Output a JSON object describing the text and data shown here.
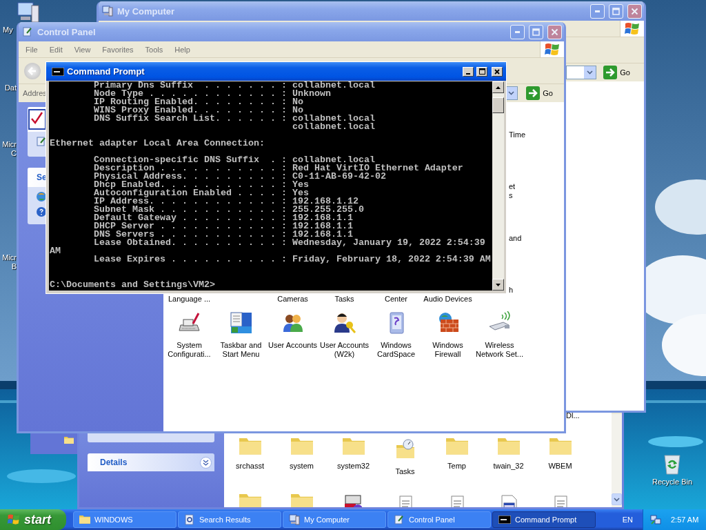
{
  "desktop": {
    "icons": [
      {
        "kind": "computer",
        "lines": [
          "My"
        ]
      },
      {
        "kind": "label",
        "lines": [
          "Dat"
        ]
      },
      {
        "kind": "label",
        "lines": [
          "Micr",
          "C"
        ]
      },
      {
        "kind": "label",
        "lines": [
          "Micr",
          "B"
        ]
      }
    ],
    "recycle_bin": {
      "label": "Recycle Bin"
    }
  },
  "windows_folder": {
    "details_title": "Details",
    "cut_label": "Dl...",
    "folders": [
      {
        "kind": "folder",
        "label": "srchasst"
      },
      {
        "kind": "folder",
        "label": "system"
      },
      {
        "kind": "folder",
        "label": "system32"
      },
      {
        "kind": "tasks",
        "label": "Tasks"
      },
      {
        "kind": "folder",
        "label": "Temp"
      },
      {
        "kind": "folder",
        "label": "twain_32"
      },
      {
        "kind": "folder",
        "label": "WBEM"
      }
    ],
    "files": [
      {
        "kind": "folder"
      },
      {
        "kind": "folder"
      },
      {
        "kind": "program"
      },
      {
        "kind": "text"
      },
      {
        "kind": "text"
      },
      {
        "kind": "window"
      },
      {
        "kind": "text"
      }
    ]
  },
  "my_computer": {
    "active": false,
    "title": "My Computer",
    "go": "Go"
  },
  "control_panel": {
    "active": false,
    "title": "Control Panel",
    "menu": [
      "File",
      "Edit",
      "View",
      "Favorites",
      "Tools",
      "Help"
    ],
    "address_label": "Addres",
    "go": "Go",
    "side_panel_title": "Se",
    "right_fragments": [
      "Time",
      "et",
      "s",
      "and",
      "h"
    ],
    "label_tails": [
      {
        "kind": "label",
        "text": "Language ..."
      },
      {
        "kind": "blank"
      },
      {
        "kind": "label",
        "text": "Cameras"
      },
      {
        "kind": "label",
        "text": "Tasks"
      },
      {
        "kind": "label",
        "text": "Center"
      },
      {
        "kind": "label",
        "text": "Audio Devices"
      },
      {
        "kind": "blank"
      }
    ],
    "items": [
      {
        "kind": "sysconfig",
        "lines": [
          "System",
          "Configurati..."
        ]
      },
      {
        "kind": "taskbar",
        "lines": [
          "Taskbar and",
          "Start Menu"
        ]
      },
      {
        "kind": "users",
        "lines": [
          "User Accounts"
        ]
      },
      {
        "kind": "userkey",
        "lines": [
          "User Accounts",
          "(W2k)"
        ]
      },
      {
        "kind": "cardspace",
        "lines": [
          "Windows",
          "CardSpace"
        ]
      },
      {
        "kind": "firewall",
        "lines": [
          "Windows",
          "Firewall"
        ]
      },
      {
        "kind": "wireless",
        "lines": [
          "Wireless",
          "Network Set..."
        ]
      }
    ]
  },
  "command_prompt": {
    "active": true,
    "title": "Command Prompt",
    "blocks": [
      {
        "lines": [
          "        Primary Dns Suffix  . . . . . . . : collabnet.local",
          "        Node Type . . . . . . . . . . . . : Unknown",
          "        IP Routing Enabled. . . . . . . . : No",
          "        WINS Proxy Enabled. . . . . . . . : No",
          "        DNS Suffix Search List. . . . . . : collabnet.local",
          "                                            collabnet.local"
        ]
      },
      {
        "lines": [
          "Ethernet adapter Local Area Connection:"
        ]
      },
      {
        "lines": [
          "        Connection-specific DNS Suffix  . : collabnet.local",
          "        Description . . . . . . . . . . . : Red Hat VirtIO Ethernet Adapter",
          "        Physical Address. . . . . . . . . : C0-11-AB-69-42-02",
          "        Dhcp Enabled. . . . . . . . . . . : Yes",
          "        Autoconfiguration Enabled . . . . : Yes",
          "        IP Address. . . . . . . . . . . . : 192.168.1.12",
          "        Subnet Mask . . . . . . . . . . . : 255.255.255.0",
          "        Default Gateway . . . . . . . . . : 192.168.1.1",
          "        DHCP Server . . . . . . . . . . . : 192.168.1.1",
          "        DNS Servers . . . . . . . . . . . : 192.168.1.1",
          "        Lease Obtained. . . . . . . . . . : Wednesday, January 19, 2022 2:54:39",
          "AM",
          "        Lease Expires . . . . . . . . . . : Friday, February 18, 2022 2:54:39 AM"
        ]
      },
      {
        "lines": [
          "C:\\Documents and Settings\\VM2>"
        ]
      }
    ]
  },
  "taskbar": {
    "start": "start",
    "tasks": [
      {
        "kind": "folder",
        "label": "WINDOWS",
        "selected": false
      },
      {
        "kind": "search",
        "label": "Search Results",
        "selected": false
      },
      {
        "kind": "computer",
        "label": "My Computer",
        "selected": false
      },
      {
        "kind": "controlpanel",
        "label": "Control Panel",
        "selected": false
      },
      {
        "kind": "console",
        "label": "Command Prompt",
        "selected": true
      }
    ],
    "language": "EN",
    "clock": "2:57 AM"
  }
}
